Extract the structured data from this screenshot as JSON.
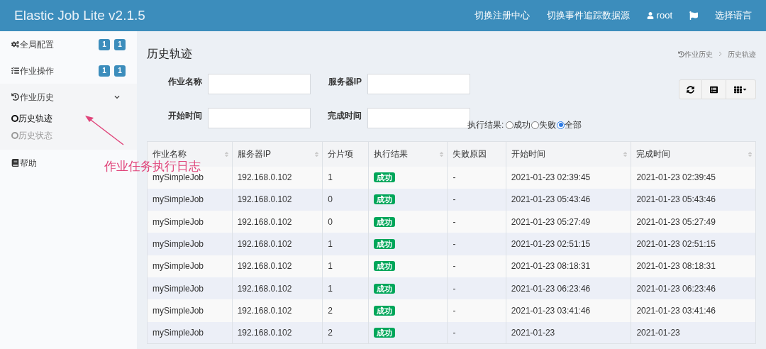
{
  "header": {
    "title": "Elastic Job Lite v2.1.5",
    "links": [
      {
        "kind": "text",
        "label": "切换注册中心"
      },
      {
        "kind": "text",
        "label": "切换事件追踪数据源"
      },
      {
        "kind": "user",
        "label": "root"
      },
      {
        "kind": "flag"
      },
      {
        "kind": "text",
        "label": "选择语言"
      }
    ]
  },
  "sidebar": {
    "items": [
      {
        "kind": "gears",
        "label": "全局配置",
        "badges": [
          "1",
          "1"
        ]
      },
      {
        "kind": "tasks",
        "label": "作业操作",
        "badges": [
          "1",
          "1"
        ]
      },
      {
        "kind": "history",
        "label": "作业历史",
        "expanded": true,
        "children": [
          {
            "label": "历史轨迹",
            "selected": true
          },
          {
            "label": "历史状态",
            "selected": false
          }
        ]
      },
      {
        "kind": "book",
        "label": "帮助"
      }
    ]
  },
  "annotation": {
    "text": "作业任务执行日志"
  },
  "page": {
    "title": "历史轨迹",
    "breadcrumb": [
      "作业历史",
      "历史轨迹"
    ],
    "filters": [
      {
        "label": "作业名称"
      },
      {
        "label": "服务器IP"
      },
      {
        "label": "开始时间"
      },
      {
        "label": "完成时间"
      }
    ],
    "result_filter": {
      "label": "执行结果:",
      "options": [
        {
          "label": "成功",
          "selected": false
        },
        {
          "label": "失败",
          "selected": false
        },
        {
          "label": "全部",
          "selected": true
        }
      ]
    },
    "table": {
      "columns": [
        {
          "label": "作业名称",
          "sortable": true
        },
        {
          "label": "服务器IP",
          "sortable": true
        },
        {
          "label": "分片项",
          "sortable": false
        },
        {
          "label": "执行结果",
          "sortable": true
        },
        {
          "label": "失败原因",
          "sortable": false
        },
        {
          "label": "开始时间",
          "sortable": true
        },
        {
          "label": "完成时间",
          "sortable": true
        }
      ],
      "rows": [
        [
          "mySimpleJob",
          "192.168.0.102",
          "1",
          "成功",
          "-",
          "2021-01-23 02:39:45",
          "2021-01-23 02:39:45"
        ],
        [
          "mySimpleJob",
          "192.168.0.102",
          "0",
          "成功",
          "-",
          "2021-01-23 05:43:46",
          "2021-01-23 05:43:46"
        ],
        [
          "mySimpleJob",
          "192.168.0.102",
          "0",
          "成功",
          "-",
          "2021-01-23 05:27:49",
          "2021-01-23 05:27:49"
        ],
        [
          "mySimpleJob",
          "192.168.0.102",
          "1",
          "成功",
          "-",
          "2021-01-23 02:51:15",
          "2021-01-23 02:51:15"
        ],
        [
          "mySimpleJob",
          "192.168.0.102",
          "1",
          "成功",
          "-",
          "2021-01-23 08:18:31",
          "2021-01-23 08:18:31"
        ],
        [
          "mySimpleJob",
          "192.168.0.102",
          "1",
          "成功",
          "-",
          "2021-01-23 06:23:46",
          "2021-01-23 06:23:46"
        ],
        [
          "mySimpleJob",
          "192.168.0.102",
          "2",
          "成功",
          "-",
          "2021-01-23 03:41:46",
          "2021-01-23 03:41:46"
        ],
        [
          "mySimpleJob",
          "192.168.0.102",
          "2",
          "成功",
          "-",
          "2021-01-23",
          "2021-01-23"
        ]
      ]
    }
  }
}
